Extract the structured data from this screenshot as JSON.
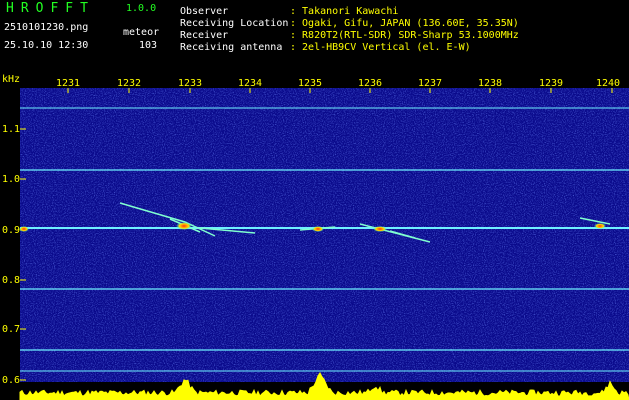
{
  "app": {
    "logo": "HROFFT",
    "version": "1.0.0"
  },
  "info": {
    "filename": "2510101230.png",
    "datetime": "25.10.10 12:30",
    "mode_label": "meteor",
    "count": "103"
  },
  "station": [
    {
      "label": "Observer",
      "value": ": Takanori Kawachi"
    },
    {
      "label": "Receiving Location",
      "value": ": Ogaki, Gifu, JAPAN (136.60E, 35.35N)"
    },
    {
      "label": "Receiver",
      "value": ": R820T2(RTL-SDR) SDR-Sharp 53.1000MHz"
    },
    {
      "label": "Receiving antenna",
      "value": ": 2el-HB9CV Vertical (el. E-W)"
    }
  ],
  "axes": {
    "y_unit": "kHz",
    "y_ticks": [
      "1.1",
      "1.0",
      "0.9",
      "0.8",
      "0.7",
      "0.6"
    ],
    "x_ticks": [
      "1231",
      "1232",
      "1233",
      "1234",
      "1235",
      "1236",
      "1237",
      "1238",
      "1239",
      "1240"
    ]
  },
  "colors": {
    "background": "#000000",
    "spectrum_bg": "#0a0a8c",
    "carrier_lines": "#6ff0ff",
    "labels": "#ffff00",
    "logo": "#22ff22"
  }
}
